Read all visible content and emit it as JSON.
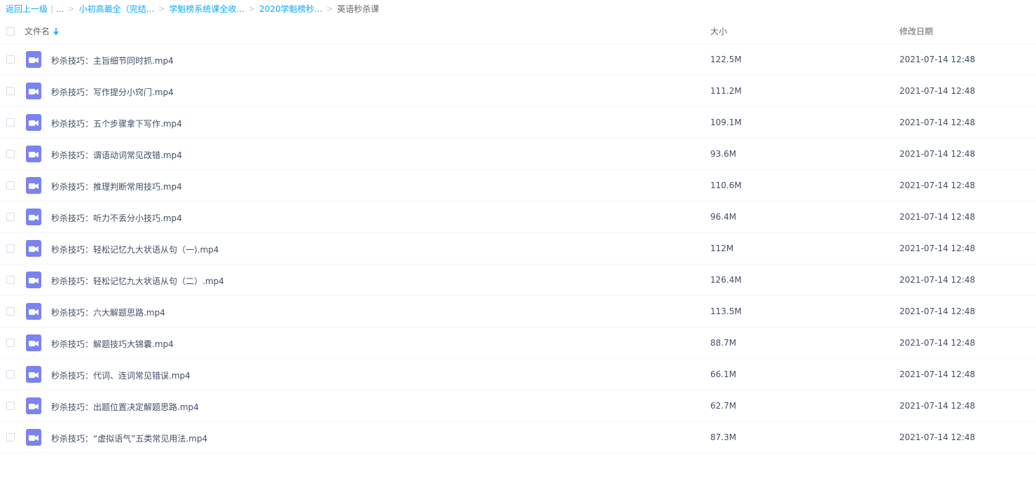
{
  "breadcrumb": {
    "back": "返回上一级",
    "pipe": "|",
    "ellipsis": "...",
    "sep": ">",
    "path": [
      "小初高最全（完结...",
      "学魁榜系统课全收...",
      "2020学魁榜秒..."
    ],
    "current": "英语秒杀课"
  },
  "table": {
    "headers": {
      "name": "文件名",
      "size": "大小",
      "date": "修改日期"
    },
    "sort_icon": "arrow-down-icon",
    "file_icon": "video-file-icon",
    "rows": [
      {
        "name": "秒杀技巧：主旨细节同时抓.mp4",
        "size": "122.5M",
        "date": "2021-07-14 12:48"
      },
      {
        "name": "秒杀技巧：写作提分小窍门.mp4",
        "size": "111.2M",
        "date": "2021-07-14 12:48"
      },
      {
        "name": "秒杀技巧：五个步骤拿下写作.mp4",
        "size": "109.1M",
        "date": "2021-07-14 12:48"
      },
      {
        "name": "秒杀技巧：谓语动词常见改错.mp4",
        "size": "93.6M",
        "date": "2021-07-14 12:48"
      },
      {
        "name": "秒杀技巧：推理判断常用技巧.mp4",
        "size": "110.6M",
        "date": "2021-07-14 12:48"
      },
      {
        "name": "秒杀技巧：听力不丢分小技巧.mp4",
        "size": "96.4M",
        "date": "2021-07-14 12:48"
      },
      {
        "name": "秒杀技巧：轻松记忆九大状语从句（一).mp4",
        "size": "112M",
        "date": "2021-07-14 12:48"
      },
      {
        "name": "秒杀技巧：轻松记忆九大状语从句（二）.mp4",
        "size": "126.4M",
        "date": "2021-07-14 12:48"
      },
      {
        "name": "秒杀技巧：六大解题思路.mp4",
        "size": "113.5M",
        "date": "2021-07-14 12:48"
      },
      {
        "name": "秒杀技巧：解题技巧大锦囊.mp4",
        "size": "88.7M",
        "date": "2021-07-14 12:48"
      },
      {
        "name": "秒杀技巧：代词、连词常见错误.mp4",
        "size": "66.1M",
        "date": "2021-07-14 12:48"
      },
      {
        "name": "秒杀技巧：出题位置决定解题思路.mp4",
        "size": "62.7M",
        "date": "2021-07-14 12:48"
      },
      {
        "name": "秒杀技巧：“虚拟语气”五类常见用法.mp4",
        "size": "87.3M",
        "date": "2021-07-14 12:48"
      }
    ]
  },
  "colors": {
    "link": "#09aaff",
    "icon": "#7b83f0",
    "text": "#424e67"
  }
}
